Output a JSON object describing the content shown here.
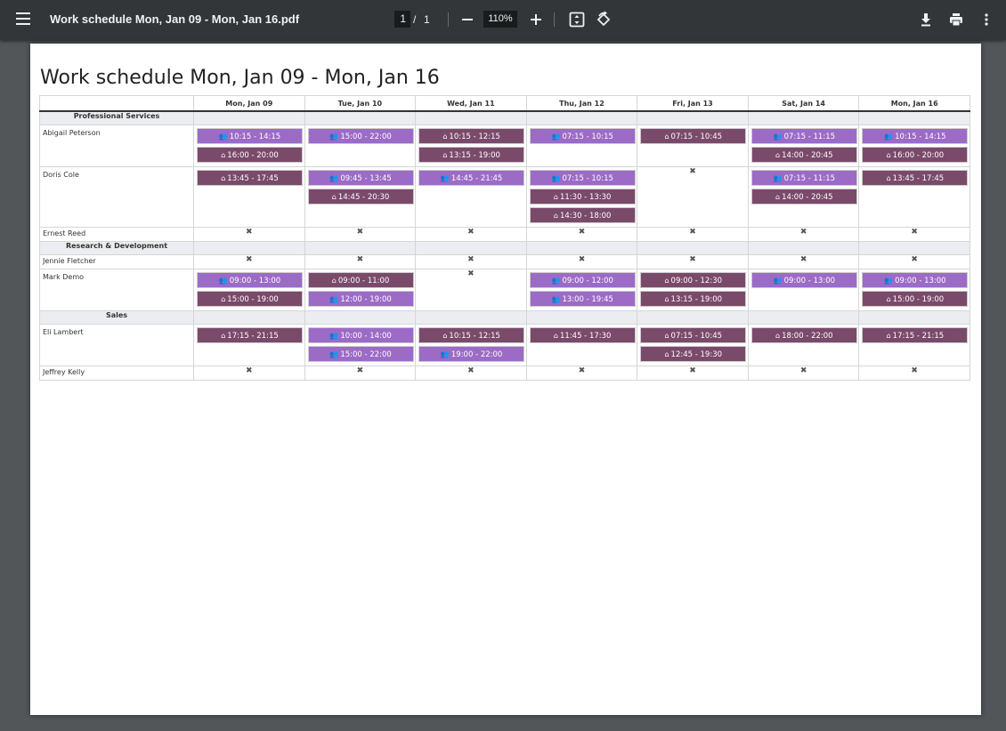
{
  "toolbar": {
    "title": "Work schedule Mon, Jan 09 - Mon, Jan 16.pdf",
    "page_current": "1",
    "page_sep": "/",
    "page_total": "1",
    "zoom": "110%"
  },
  "document": {
    "title": "Work schedule Mon, Jan 09 - Mon, Jan 16",
    "days": [
      "Mon, Jan 09",
      "Tue, Jan 10",
      "Wed, Jan 11",
      "Thu, Jan 12",
      "Fri, Jan 13",
      "Sat, Jan 14",
      "Mon, Jan 16"
    ],
    "colors": {
      "team_shift": "#9b6bc6",
      "home_shift": "#7a4a6b"
    },
    "icons": {
      "team": "team-icon",
      "home": "home-icon",
      "absent": "absent-icon"
    },
    "groups": [
      {
        "name": "Professional Services",
        "employees": [
          {
            "name": "Abigail Peterson",
            "days": [
              [
                {
                  "t": "team",
                  "time": "10:15 - 14:15"
                },
                {
                  "t": "home",
                  "time": "16:00 - 20:00"
                }
              ],
              [
                {
                  "t": "team",
                  "time": "15:00 - 22:00"
                }
              ],
              [
                {
                  "t": "home",
                  "time": "10:15 - 12:15"
                },
                {
                  "t": "home",
                  "time": "13:15 - 19:00"
                }
              ],
              [
                {
                  "t": "team",
                  "time": "07:15 - 10:15"
                }
              ],
              [
                {
                  "t": "home",
                  "time": "07:15 - 10:45"
                }
              ],
              [
                {
                  "t": "team",
                  "time": "07:15 - 11:15"
                },
                {
                  "t": "home",
                  "time": "14:00 - 20:45"
                }
              ],
              [
                {
                  "t": "team",
                  "time": "10:15 - 14:15"
                },
                {
                  "t": "home",
                  "time": "16:00 - 20:00"
                }
              ]
            ]
          },
          {
            "name": "Doris Cole",
            "days": [
              [
                {
                  "t": "home",
                  "time": "13:45 - 17:45"
                }
              ],
              [
                {
                  "t": "team",
                  "time": "09:45 - 13:45"
                },
                {
                  "t": "home",
                  "time": "14:45 - 20:30"
                }
              ],
              [
                {
                  "t": "team",
                  "time": "14:45 - 21:45"
                }
              ],
              [
                {
                  "t": "team",
                  "time": "07:15 - 10:15"
                },
                {
                  "t": "home",
                  "time": "11:30 - 13:30"
                },
                {
                  "t": "home",
                  "time": "14:30 - 18:00"
                }
              ],
              [],
              [
                {
                  "t": "team",
                  "time": "07:15 - 11:15"
                },
                {
                  "t": "home",
                  "time": "14:00 - 20:45"
                }
              ],
              [
                {
                  "t": "home",
                  "time": "13:45 - 17:45"
                }
              ]
            ]
          },
          {
            "name": "Ernest Reed",
            "days": [
              [],
              [],
              [],
              [],
              [],
              [],
              []
            ]
          }
        ]
      },
      {
        "name": "Research & Development",
        "employees": [
          {
            "name": "Jennie Fletcher",
            "days": [
              [],
              [],
              [],
              [],
              [],
              [],
              []
            ]
          },
          {
            "name": "Mark Demo",
            "days": [
              [
                {
                  "t": "team",
                  "time": "09:00 - 13:00"
                },
                {
                  "t": "home",
                  "time": "15:00 - 19:00"
                }
              ],
              [
                {
                  "t": "home",
                  "time": "09:00 - 11:00"
                },
                {
                  "t": "team",
                  "time": "12:00 - 19:00"
                }
              ],
              [],
              [
                {
                  "t": "team",
                  "time": "09:00 - 12:00"
                },
                {
                  "t": "team",
                  "time": "13:00 - 19:45"
                }
              ],
              [
                {
                  "t": "home",
                  "time": "09:00 - 12:30"
                },
                {
                  "t": "home",
                  "time": "13:15 - 19:00"
                }
              ],
              [
                {
                  "t": "team",
                  "time": "09:00 - 13:00"
                }
              ],
              [
                {
                  "t": "team",
                  "time": "09:00 - 13:00"
                },
                {
                  "t": "home",
                  "time": "15:00 - 19:00"
                }
              ]
            ]
          }
        ]
      },
      {
        "name": "Sales",
        "employees": [
          {
            "name": "Eli Lambert",
            "days": [
              [
                {
                  "t": "home",
                  "time": "17:15 - 21:15"
                }
              ],
              [
                {
                  "t": "team",
                  "time": "10:00 - 14:00"
                },
                {
                  "t": "team",
                  "time": "15:00 - 22:00"
                }
              ],
              [
                {
                  "t": "home",
                  "time": "10:15 - 12:15"
                },
                {
                  "t": "team",
                  "time": "19:00 - 22:00"
                }
              ],
              [
                {
                  "t": "home",
                  "time": "11:45 - 17:30"
                }
              ],
              [
                {
                  "t": "home",
                  "time": "07:15 - 10:45"
                },
                {
                  "t": "home",
                  "time": "12:45 - 19:30"
                }
              ],
              [
                {
                  "t": "home",
                  "time": "18:00 - 22:00"
                }
              ],
              [
                {
                  "t": "home",
                  "time": "17:15 - 21:15"
                }
              ]
            ]
          },
          {
            "name": "Jeffrey Kelly",
            "days": [
              [],
              [],
              [],
              [],
              [],
              [],
              []
            ]
          }
        ]
      }
    ]
  }
}
